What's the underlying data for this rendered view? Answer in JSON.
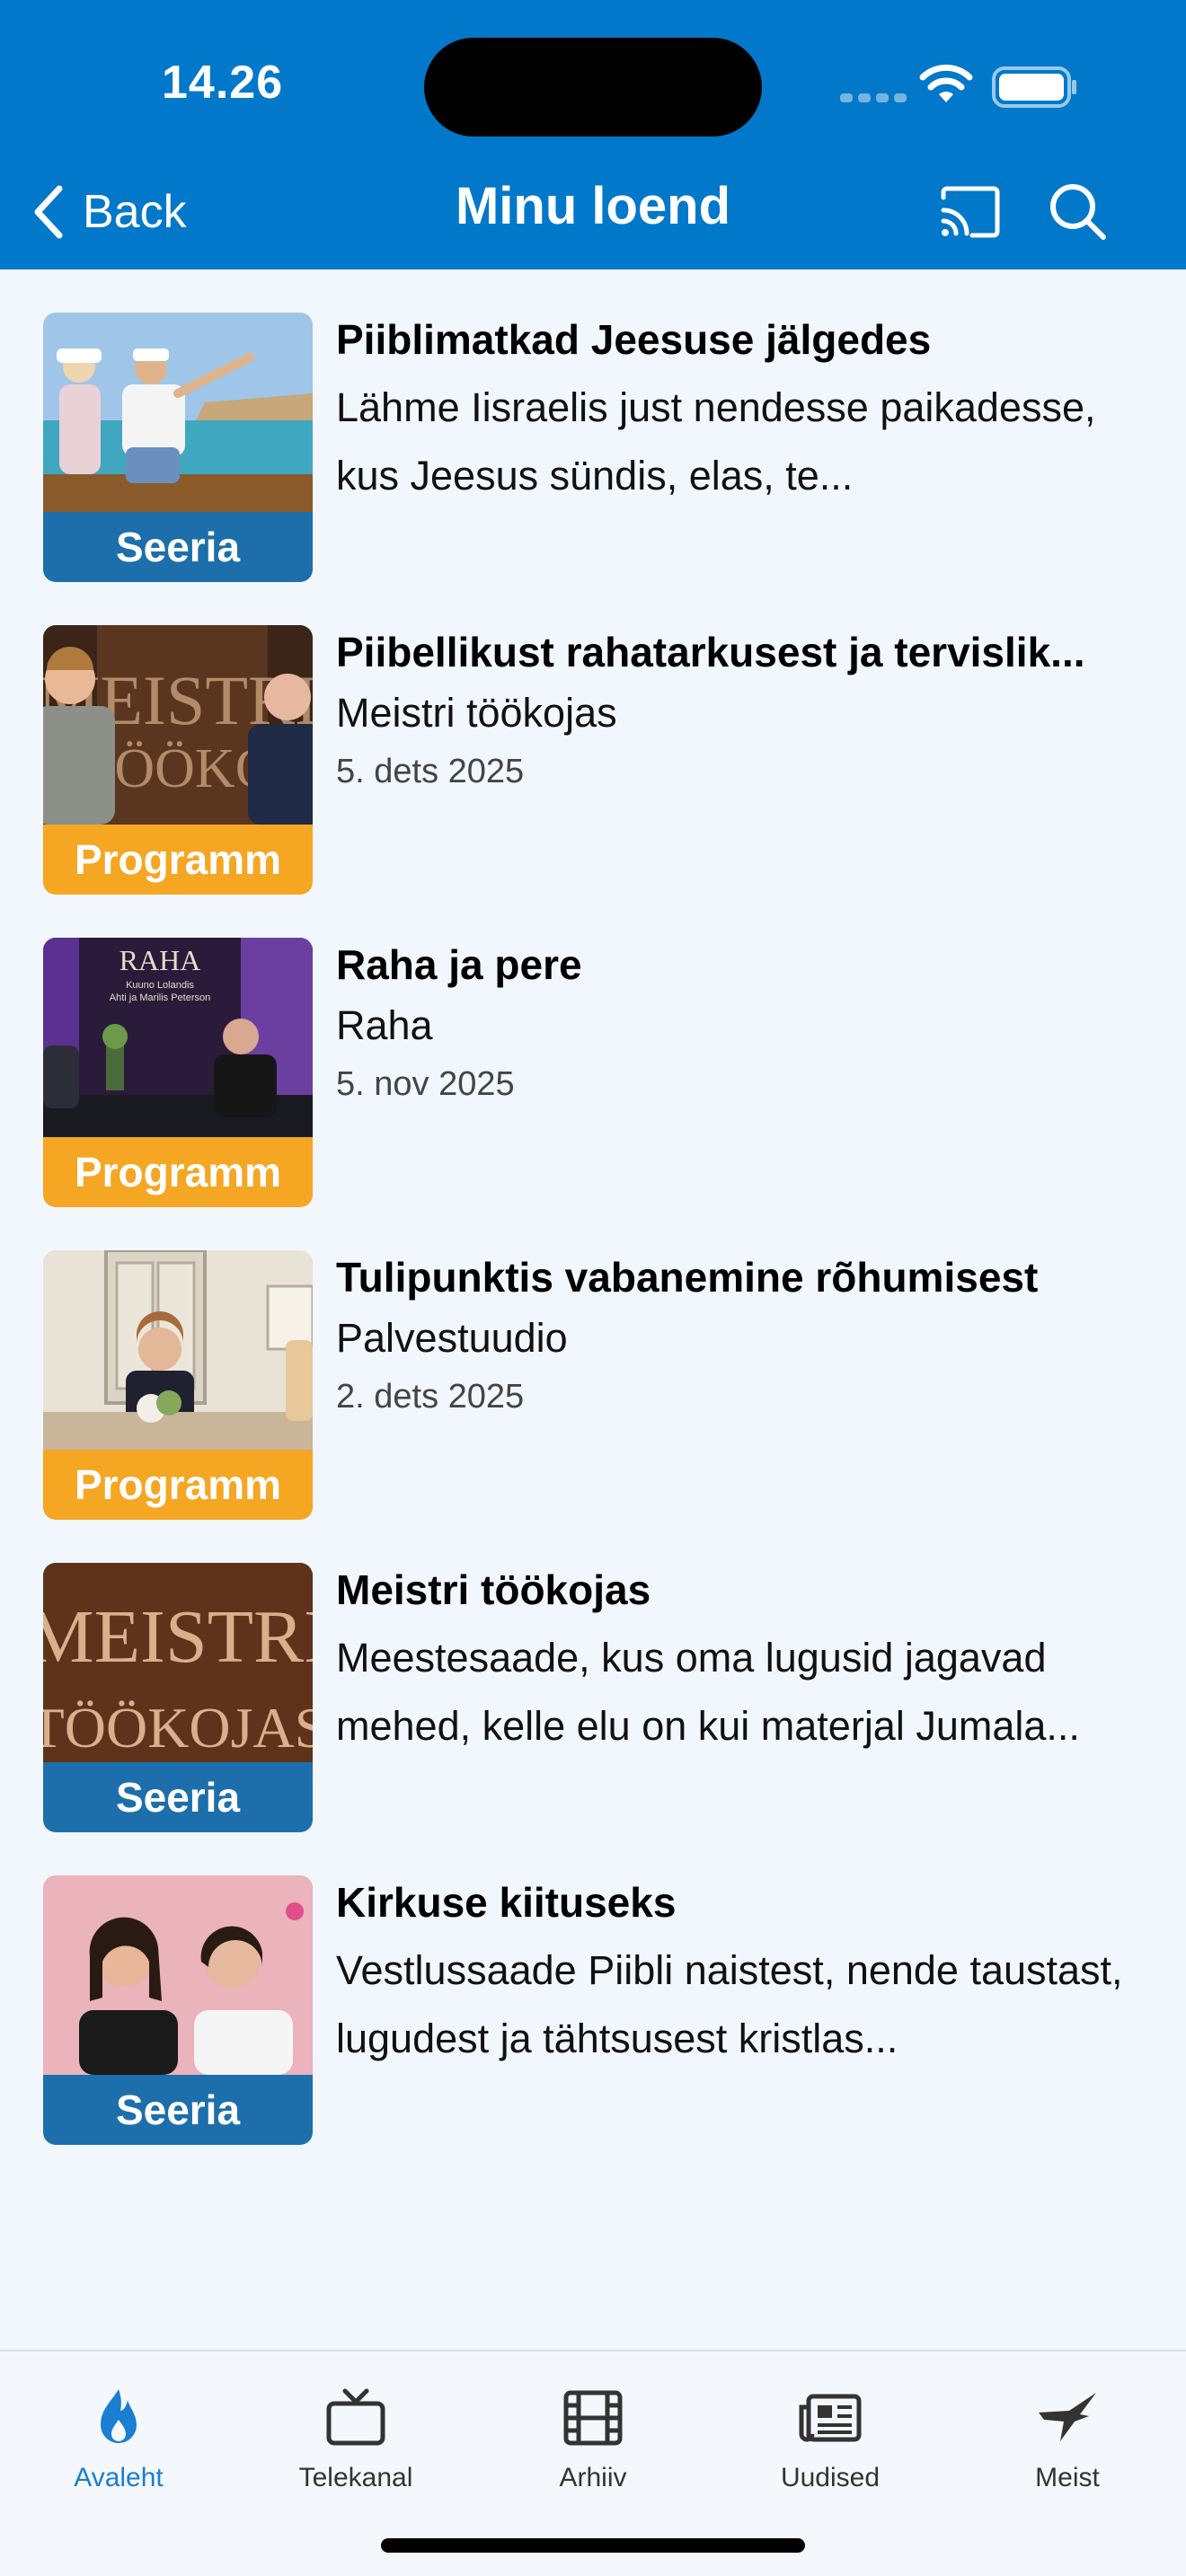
{
  "status_bar": {
    "time": "14.26"
  },
  "header": {
    "back_label": "Back",
    "title": "Minu loend",
    "background": "#0178c9"
  },
  "items": [
    {
      "title": "Piiblimatkad Jeesuse jälgedes",
      "description": "Lähme Iisraelis just nendesse paikadesse, kus Jeesus sündis, elas, te...",
      "badge": "Seeria",
      "thumb": "people-on-boat"
    },
    {
      "title": "Piibellikust rahatarkusest ja tervislik...",
      "subtitle": "Meistri töökojas",
      "date": "5. dets 2025",
      "badge": "Programm",
      "thumb": "two-men-meistri-set"
    },
    {
      "title": "Raha ja pere",
      "subtitle": "Raha",
      "date": "5. nov 2025",
      "badge": "Programm",
      "thumb": "raha-studio",
      "art_text": "RAHA",
      "art_small_1": "Kuuno Lolandis",
      "art_small_2": "Ahti ja Marilis Peterson"
    },
    {
      "title": "Tulipunktis vabanemine rõhumisest",
      "subtitle": "Palvestuudio",
      "date": "2. dets 2025",
      "badge": "Programm",
      "thumb": "woman-studio"
    },
    {
      "title": "Meistri töökojas",
      "description": "Meestesaade, kus oma lugusid jagavad mehed, kelle elu on kui materjal Jumala...",
      "badge": "Seeria",
      "thumb": "meistri-logo",
      "art_text_1": "MEISTRI",
      "art_text_2": "TÖÖKOJAS"
    },
    {
      "title": "Kirkuse kiituseks",
      "description": "Vestlussaade Piibli naistest, nende taustast, lugudest ja tähtsusest kristlas...",
      "badge": "Seeria",
      "thumb": "two-women"
    }
  ],
  "tabbar": {
    "tabs": [
      {
        "label": "Avaleht",
        "icon": "flame-icon",
        "active": true
      },
      {
        "label": "Telekanal",
        "icon": "tv-icon",
        "active": false
      },
      {
        "label": "Arhiiv",
        "icon": "film-icon",
        "active": false
      },
      {
        "label": "Uudised",
        "icon": "newspaper-icon",
        "active": false
      },
      {
        "label": "Meist",
        "icon": "bird-icon",
        "active": false
      }
    ],
    "active_color": "#1a7fd0"
  },
  "colors": {
    "seeria_badge": "#1d6fab",
    "programm_badge": "#f5a623",
    "background": "#f1f7fd"
  }
}
